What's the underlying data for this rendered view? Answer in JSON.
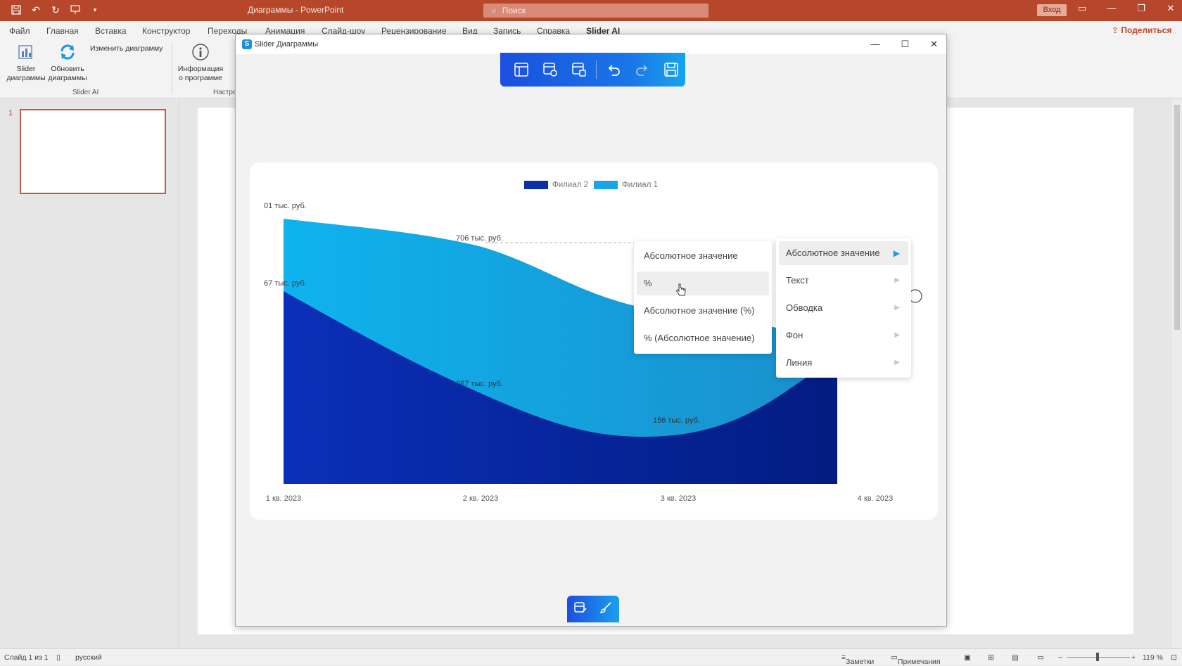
{
  "app": {
    "title": "Диаграммы - PowerPoint",
    "search_placeholder": "Поиск",
    "login_label": "Вход",
    "share_label": "Поделиться"
  },
  "ribbon_tabs": [
    "Файл",
    "Главная",
    "Вставка",
    "Конструктор",
    "Переходы",
    "Анимация",
    "Слайд-шоу",
    "Рецензирование",
    "Вид",
    "Запись",
    "Справка",
    "Slider AI"
  ],
  "ribbon": {
    "slider_charts": "Slider\nдиаграммы",
    "slider_charts_l1": "Slider",
    "slider_charts_l2": "диаграммы",
    "refresh_l1": "Обновить",
    "refresh_l2": "диаграммы",
    "edit_chart": "Изменить диаграмму",
    "info_l1": "Информация",
    "info_l2": "о программе",
    "group_slider": "Slider AI",
    "group_settings": "Настро"
  },
  "slides": {
    "current_number": "1"
  },
  "dialog": {
    "title": "Slider Диаграммы",
    "logo": "S"
  },
  "chart_data": {
    "type": "area",
    "categories": [
      "1 кв. 2023",
      "2 кв. 2023",
      "3 кв. 2023",
      "4 кв. 2023"
    ],
    "series": [
      {
        "name": "Филиал 2",
        "color": "#0a2fa8"
      },
      {
        "name": "Филиал 1",
        "color": "#19a6e8"
      }
    ],
    "annotations": [
      "01 тыс. руб.",
      "67 тыс. руб.",
      "706 тыс. руб.",
      "267 тыс. руб.",
      "156 тыс. руб."
    ]
  },
  "menu_left": {
    "items": [
      "Абсолютное значение",
      "%",
      "Абсолютное значение (%)",
      "% (Абсолютное значение)"
    ],
    "active_index": 1
  },
  "menu_right": {
    "items": [
      "Абсолютное значение",
      "Текст",
      "Обводка",
      "Фон",
      "Линия"
    ],
    "active_index": 0
  },
  "status": {
    "slide_info": "Слайд 1 из 1",
    "language": "русский",
    "notes": "Заметки",
    "comments": "Примечания",
    "zoom": "119 %"
  }
}
